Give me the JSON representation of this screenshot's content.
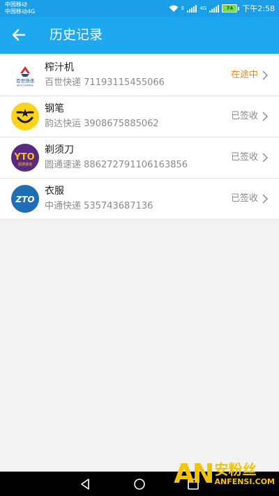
{
  "status_bar": {
    "carrier_1": "中国移动",
    "carrier_2": "中国移动4G",
    "network_1": "E",
    "network_2": "4G",
    "battery": "74",
    "time": "下午2:58"
  },
  "header": {
    "title": "历史记录"
  },
  "items": [
    {
      "name": "榨汁机",
      "carrier": "百世快递",
      "tracking": "71193115455066",
      "status": "在途中",
      "logo_text": "百世快递",
      "logo_sub": "BEST EXPRESS"
    },
    {
      "name": "钢笔",
      "carrier": "韵达快运",
      "tracking": "3908675885062",
      "status": "已签收"
    },
    {
      "name": "剃须刀",
      "carrier": "圆通速递",
      "tracking": "886272791106163856",
      "status": "已签收",
      "logo_text": "YTO",
      "logo_sub": "圆通速递"
    },
    {
      "name": "衣服",
      "carrier": "中通快递",
      "tracking": "535743687136",
      "status": "已签收",
      "logo_text": "ZTO"
    }
  ],
  "watermark": {
    "mark": "AN",
    "cn": "安粉丝",
    "en": "ANFENSI.COM"
  },
  "colors": {
    "app_bar": "#1ea8f0",
    "in_transit": "#e28e1e",
    "delivered": "#8b8b8b"
  }
}
